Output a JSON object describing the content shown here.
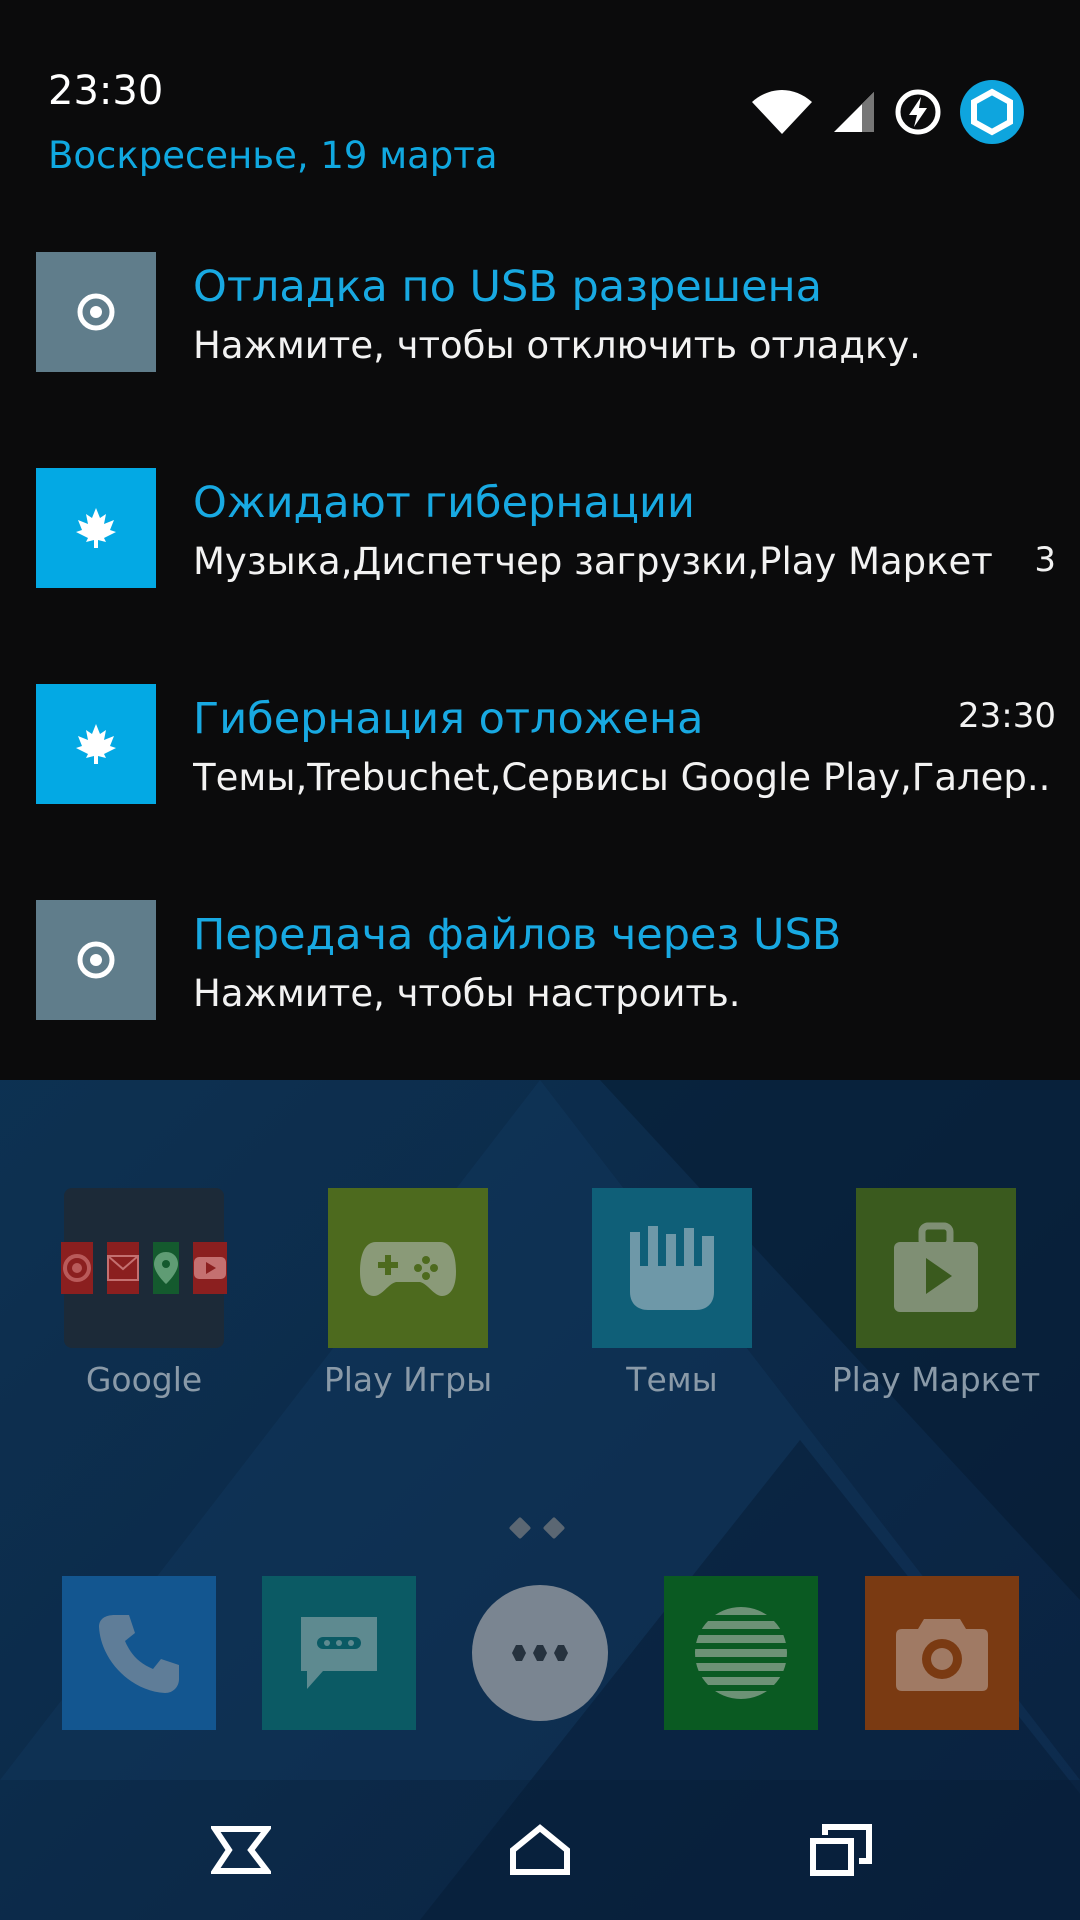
{
  "status": {
    "time": "23:30",
    "date": "Воскресенье, 19 марта",
    "icons": [
      "wifi-icon",
      "signal-icon",
      "battery-charging-icon",
      "profile-hex-icon"
    ]
  },
  "notifications": [
    {
      "icon": "usb-icon",
      "title": "Отладка по USB разрешена",
      "text": "Нажмите, чтобы отключить отладку.",
      "side": ""
    },
    {
      "icon": "maple-leaf-icon",
      "title": "Ожидают гибернации",
      "text": "Музыка,Диспетчер загрузки,Play Маркет",
      "side": "3"
    },
    {
      "icon": "maple-leaf-icon",
      "title": "Гибернация отложена",
      "text": "Темы,Trebuchet,Сервисы Google Play,Галер..",
      "side": "23:30"
    },
    {
      "icon": "usb-icon",
      "title": "Передача файлов через USB",
      "text": "Нажмите, чтобы настроить.",
      "side": ""
    }
  ],
  "home": {
    "apps": [
      {
        "label": "Google"
      },
      {
        "label": "Play Игры"
      },
      {
        "label": "Темы"
      },
      {
        "label": "Play Маркет"
      }
    ],
    "dock": [
      "phone-icon",
      "messaging-icon",
      "app-drawer-icon",
      "music-icon",
      "camera-icon"
    ]
  },
  "nav": [
    "back-icon",
    "home-icon",
    "recents-icon"
  ],
  "colors": {
    "accent": "#18a9e2",
    "usb_tile": "#607d8b",
    "hibernation_tile": "#03a9e4"
  }
}
